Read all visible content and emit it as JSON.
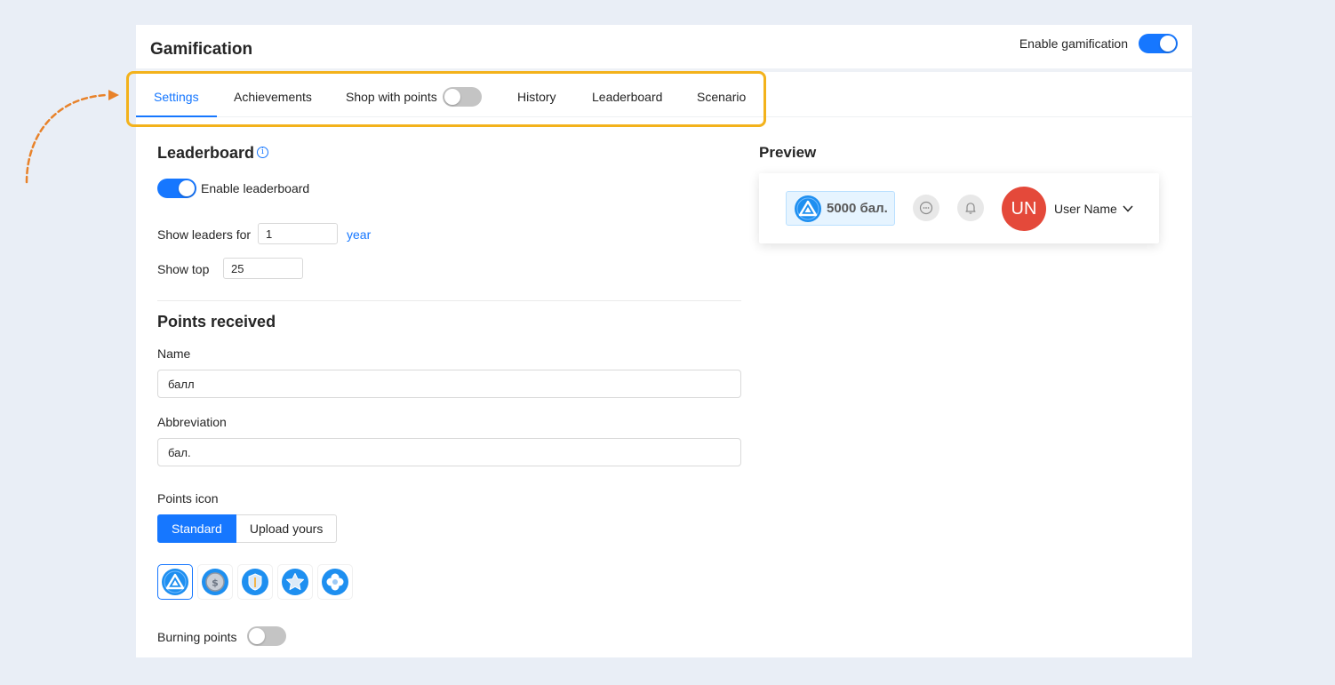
{
  "app": {
    "title": "Gamification",
    "enable_label": "Enable gamification",
    "enabled": true
  },
  "tabs": [
    {
      "label": "Settings",
      "active": true
    },
    {
      "label": "Achievements"
    },
    {
      "label": "Shop with points",
      "toggle_on": false
    },
    {
      "label": "History"
    },
    {
      "label": "Leaderboard"
    },
    {
      "label": "Scenario"
    }
  ],
  "leaderboard": {
    "title": "Leaderboard",
    "enable_label": "Enable leaderboard",
    "enabled": true,
    "show_leaders_label": "Show leaders for",
    "show_leaders_value": "1",
    "show_leaders_unit": "year",
    "show_top_label": "Show top",
    "show_top_value": "25"
  },
  "points": {
    "title": "Points received",
    "name_label": "Name",
    "name_value": "балл",
    "abbr_label": "Abbreviation",
    "abbr_value": "бал.",
    "icon_label": "Points icon",
    "icon_mode_standard": "Standard",
    "icon_mode_upload": "Upload yours",
    "icon_mode_selected": "Standard",
    "icon_options": [
      "triangle-coin-icon",
      "dollar-coin-icon",
      "shield-coin-icon",
      "star-coin-icon",
      "flower-coin-icon"
    ],
    "icon_selected": "triangle-coin-icon",
    "burning_label": "Burning points",
    "burning_enabled": false
  },
  "preview": {
    "title": "Preview",
    "points_display": "5000 бал.",
    "avatar_initials": "UN",
    "user_name": "User Name"
  },
  "colors": {
    "accent": "#1677ff",
    "highlight": "#f3b21b",
    "arrow": "#e8822a",
    "avatar": "#e4493a"
  }
}
